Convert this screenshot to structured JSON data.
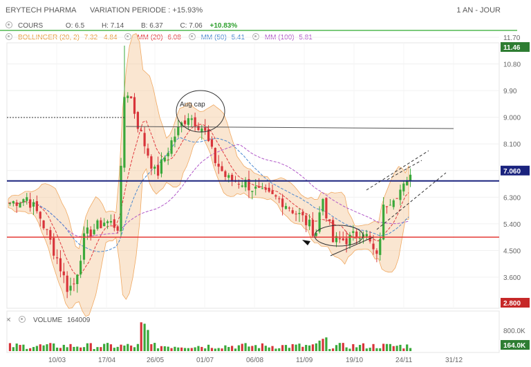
{
  "header": {
    "title": "ERYTECH PHARMA",
    "variation": "VARIATION PERIODE : +15.93%",
    "range": "1 AN - JOUR"
  },
  "quote": {
    "series_label": "COURS",
    "open": "O: 6.5",
    "high": "H: 7.14",
    "low": "B: 6.37",
    "close": "C: 7.06",
    "change": "+10.83%"
  },
  "indicators": {
    "bollinger": "BOLLINGER (20, 2)",
    "bollinger_vals": "7.32 - 4.84",
    "mm20": "MM (20)",
    "mm20_val": "6.08",
    "mm50": "MM (50)",
    "mm50_val": "5.41",
    "mm100": "MM (100)",
    "mm100_val": "5.81"
  },
  "volume": {
    "label": "VOLUME",
    "value": "164009",
    "axis_tick": "800.0K",
    "badge": "164.0K"
  },
  "colors": {
    "up": "#3aa83a",
    "down": "#d8343a",
    "band": "#f5c89a",
    "mm20": "#e0393e",
    "mm50": "#4a88d0",
    "mm100": "#b057c8",
    "resistance": "#1a237e",
    "support": "#e53935",
    "last_price": "#2e7d32",
    "low_badge": "#c62828"
  },
  "chart_data": {
    "type": "candlestick",
    "y_ticks": [
      "11.70",
      "10.80",
      "9.90",
      "9.000",
      "8.100",
      "7.200",
      "6.300",
      "5.400",
      "4.500",
      "3.600"
    ],
    "x_ticks": [
      "10/03",
      "17/04",
      "26/05",
      "01/07",
      "06/08",
      "11/09",
      "19/10",
      "24/11",
      "31/12"
    ],
    "last_price": "7.060",
    "high_badge": "11.46",
    "low_badge": "2.800",
    "annotation": "Aug cap",
    "resistance_level": 6.85,
    "support_level": 4.95
  }
}
